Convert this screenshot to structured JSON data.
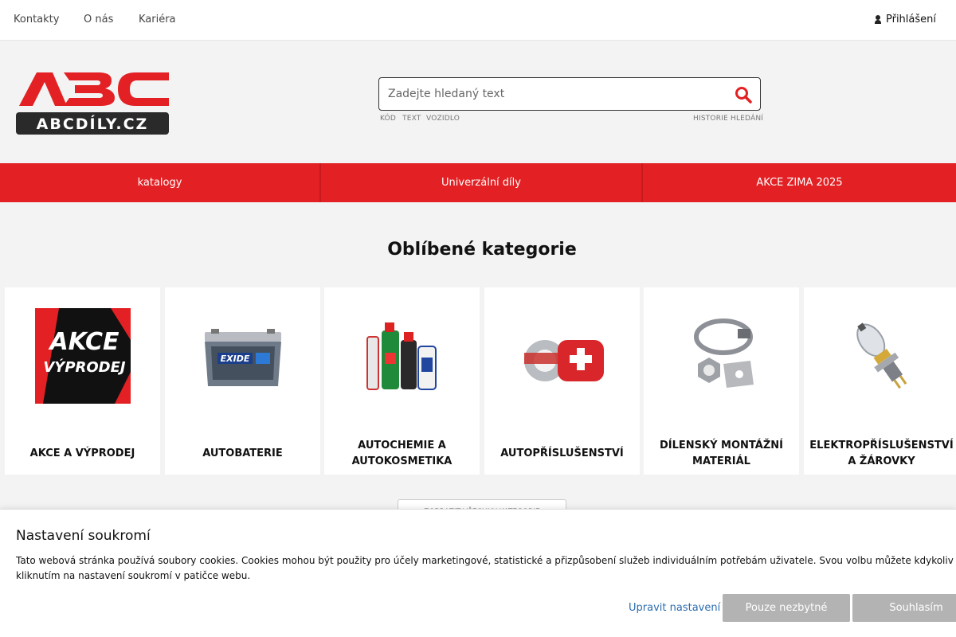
{
  "topbar": {
    "links": [
      "Kontakty",
      "O nás",
      "Kariéra"
    ],
    "login": "Přihlášení"
  },
  "logo": {
    "big": "ABC",
    "small": "ABCDÍLY.CZ"
  },
  "search": {
    "placeholder": "Zadejte hledaný text",
    "modes": [
      "KÓD",
      "TEXT",
      "VOZIDLO"
    ],
    "history": "HISTORIE HLEDÁNÍ"
  },
  "nav": {
    "items": [
      "katalogy",
      "Univerzální díly",
      "AKCE ZIMA 2025"
    ]
  },
  "categories": {
    "title": "Oblíbené kategorie",
    "items": [
      {
        "label": "AKCE A VÝPRODEJ",
        "image": "akce-vyprodej-banner",
        "banner_line1": "AKCE",
        "banner_line2": "VÝPRODEJ"
      },
      {
        "label": "AUTOBATERIE",
        "image": "car-battery",
        "brand": "EXIDE"
      },
      {
        "label": "AUTOCHEMIE A AUTOKOSMETIKA",
        "image": "car-chemicals-bottles"
      },
      {
        "label": "AUTOPŘÍSLUŠENSTVÍ",
        "image": "tape-and-first-aid-kit"
      },
      {
        "label": "DÍLENSKÝ MONTÁŽNÍ MATERIÁL",
        "image": "hose-clamp-nut-clip"
      },
      {
        "label": "ELEKTROPŘÍSLUŠENSTVÍ A ŽÁROVKY",
        "image": "headlight-bulb"
      }
    ],
    "more_button": "ZOBRAZIT VŠECHNY KATEGORIE"
  },
  "cookie": {
    "title": "Nastavení soukromí",
    "text_line1": "Tato webová stránka používá soubory cookies. Cookies mohou být použity pro účely marketingové, statistické a přizpůsobení služeb individuálním potřebám uživatele. Svou volbu můžete kdykoliv změnit",
    "text_line2": "kliknutím na nastavení soukromí v patičce webu.",
    "settings_link": "Upravit nastavení",
    "necessary_button": "Pouze nezbytné",
    "accept_button": "Souhlasím"
  },
  "colors": {
    "brand_red": "#e32124",
    "logo_dark": "#2a2a2a",
    "link_blue": "#2b6cb0",
    "button_grey": "#b3b3b3"
  }
}
